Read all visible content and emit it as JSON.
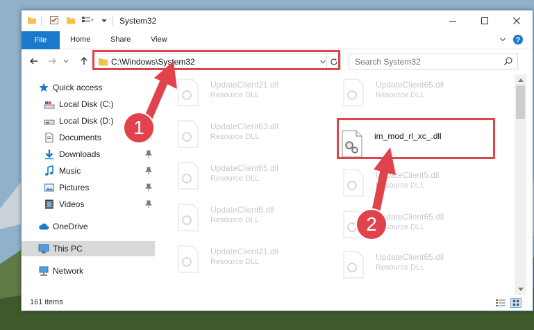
{
  "window": {
    "title": "System32",
    "controls": {
      "minimize_icon": "minimize-icon",
      "maximize_icon": "maximize-icon",
      "close_icon": "close-icon"
    }
  },
  "ribbon": {
    "tabs": [
      {
        "label": "File",
        "active": true
      },
      {
        "label": "Home"
      },
      {
        "label": "Share"
      },
      {
        "label": "View"
      }
    ],
    "help_icon": "help-icon",
    "collapse_icon": "chevron-down-icon"
  },
  "nav": {
    "address": "C:\\Windows\\System32",
    "search_placeholder": "Search System32"
  },
  "sidebar": {
    "items": [
      {
        "label": "Quick access",
        "icon": "star-icon"
      },
      {
        "label": "Local Disk (C:)",
        "icon": "drive-icon"
      },
      {
        "label": "Local Disk (D:)",
        "icon": "drive-icon"
      },
      {
        "label": "Documents",
        "icon": "documents-icon",
        "pinned": true
      },
      {
        "label": "Downloads",
        "icon": "download-icon",
        "pinned": true
      },
      {
        "label": "Music",
        "icon": "music-icon",
        "pinned": true
      },
      {
        "label": "Pictures",
        "icon": "pictures-icon",
        "pinned": true
      },
      {
        "label": "Videos",
        "icon": "videos-icon",
        "pinned": true
      },
      {
        "label": "OneDrive",
        "icon": "cloud-icon"
      },
      {
        "label": "This PC",
        "icon": "computer-icon",
        "selected": true
      },
      {
        "label": "Network",
        "icon": "network-icon"
      }
    ]
  },
  "files": {
    "left_column": [
      {
        "name": "UpdateClient21.dll",
        "type": "Resource DLL"
      },
      {
        "name": "UpdateClient63.dll",
        "type": "Resource DLL"
      },
      {
        "name": "UpdateClient65.dll",
        "type": "Resource DLL"
      },
      {
        "name": "UpdateClient5.dll",
        "type": "Resource DLL"
      },
      {
        "name": "UpdateClient21.dll",
        "type": "Resource DLL"
      }
    ],
    "right_column": [
      {
        "name": "UpdateClient65.dll",
        "type": "Resource DLL"
      },
      {
        "name": "im_mod_rl_xc_.dll",
        "type": "",
        "highlighted": true
      },
      {
        "name": "UpdateClient5.dll",
        "type": "Resource DLL"
      },
      {
        "name": "UpdateClient65.dll",
        "type": "Resource DLL"
      },
      {
        "name": "UpdateClient65.dll",
        "type": "Resource DLL"
      }
    ]
  },
  "status": {
    "item_count": "161 items"
  },
  "annotations": {
    "step1": "1",
    "step2": "2",
    "color": "#e0434b"
  },
  "colors": {
    "accent": "#1979ca",
    "selection": "#cce8ff",
    "annotation": "#e0434b"
  }
}
